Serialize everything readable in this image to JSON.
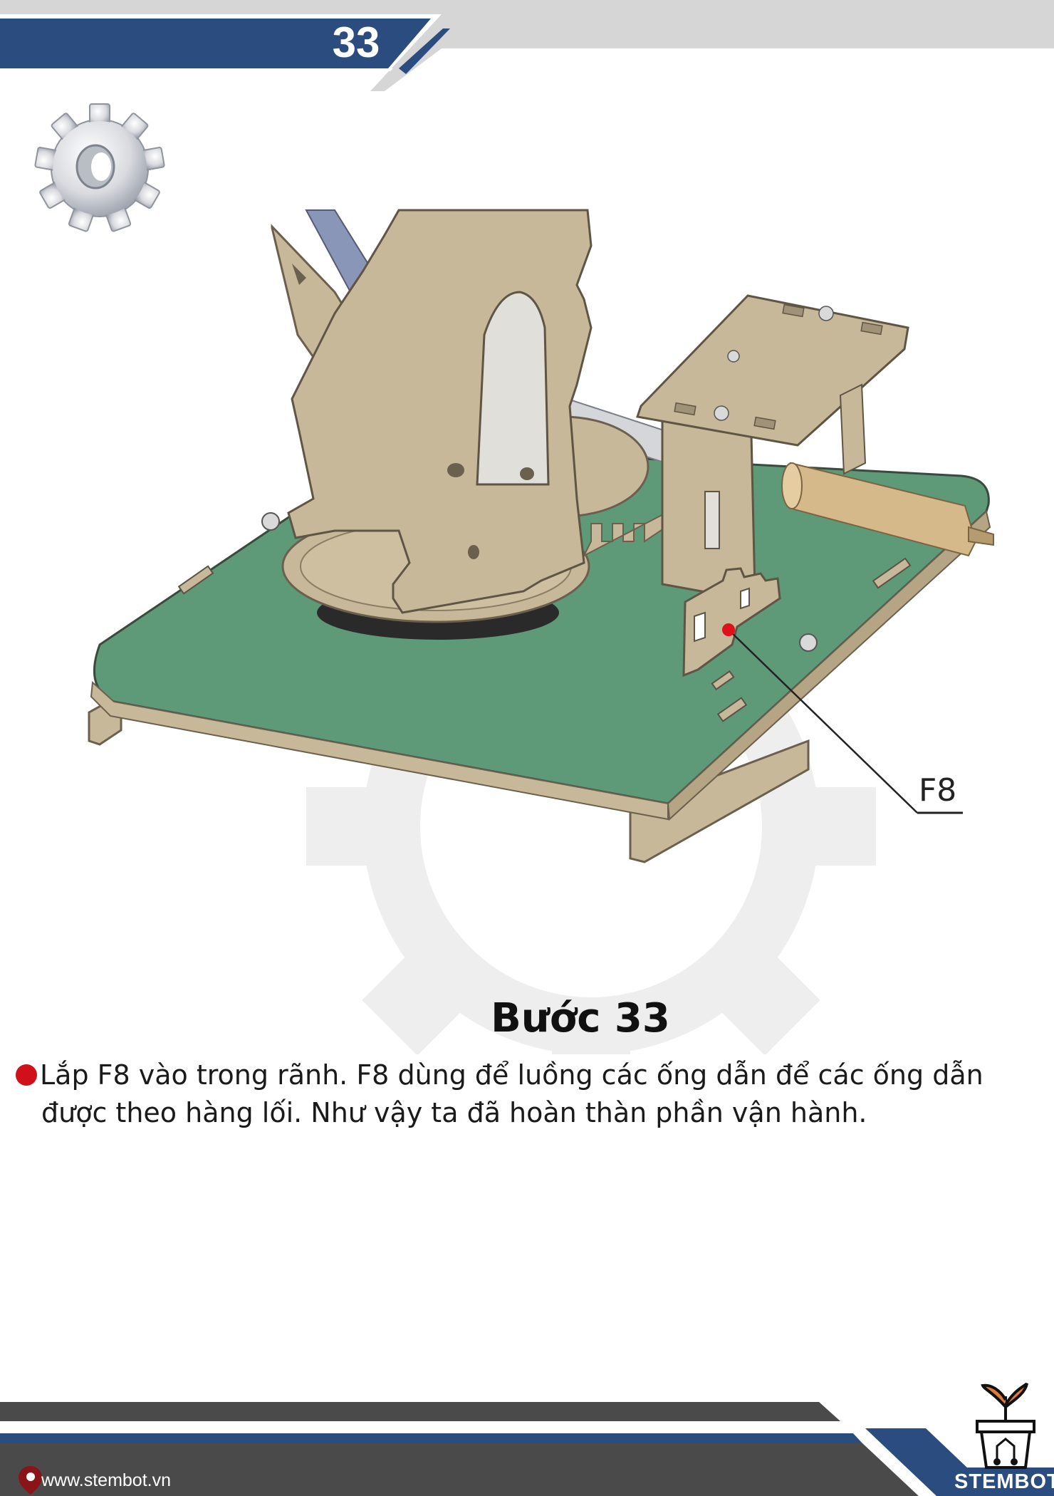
{
  "header": {
    "page_number": "33"
  },
  "figure": {
    "callout_label": "F8"
  },
  "step": {
    "title": "Bước 33",
    "line1": "Lắp F8 vào trong rãnh. F8 dùng để luồng các ống dẫn để các ống dẫn",
    "line2": "được theo hàng lối. Như vậy ta đã hoàn thàn phần vận hành."
  },
  "footer": {
    "website": "www.stembot.vn",
    "brand": "STEMBOT"
  },
  "colors": {
    "accent_blue": "#2b4c7e",
    "bullet_red": "#d0101a",
    "board_green": "#5f9a78",
    "wood": "#c8b89a"
  },
  "icons": [
    "gear-icon",
    "location-pin-icon",
    "plant-pot-logo-icon"
  ]
}
